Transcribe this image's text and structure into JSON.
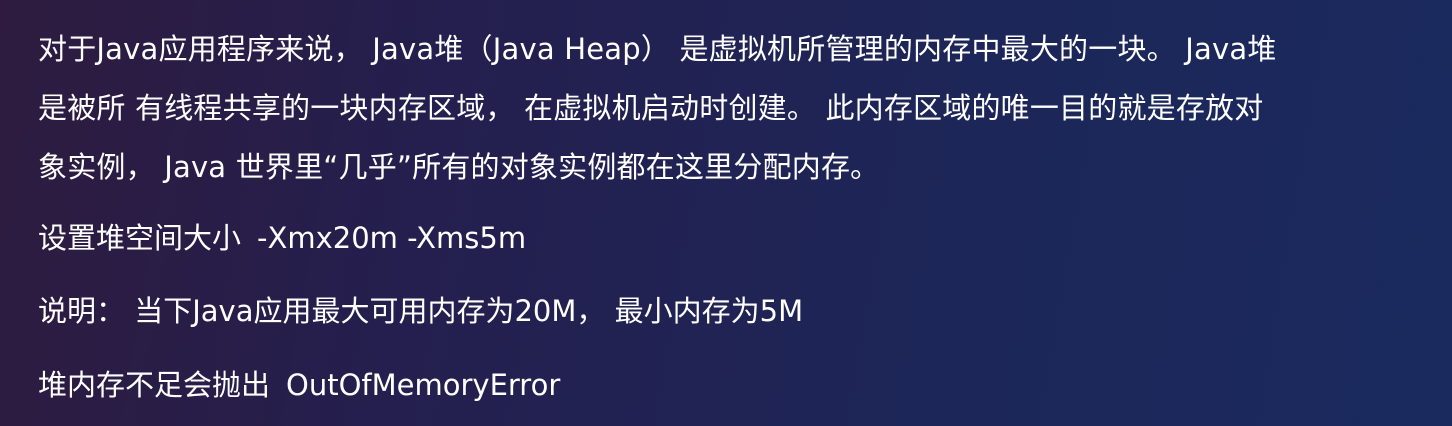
{
  "intro": {
    "lines": [
      "对于Java应用程序来说， Java堆（Java Heap） 是虚拟机所管理的内存中最大的一块。 Java堆",
      "是被所 有线程共享的一块内存区域， 在虚拟机启动时创建。 此内存区域的唯一目的就是存放对",
      "象实例， Java 世界里“几乎”所有的对象实例都在这里分配内存。"
    ]
  },
  "notes": {
    "heap_size": {
      "label": "设置堆空间大小",
      "value": "-Xmx20m -Xms5m"
    },
    "explain": {
      "text": "说明： 当下Java应用最大可用内存为20M， 最小内存为5M"
    },
    "oom": {
      "label": "堆内存不足会抛出",
      "value": "OutOfMemoryError"
    }
  }
}
